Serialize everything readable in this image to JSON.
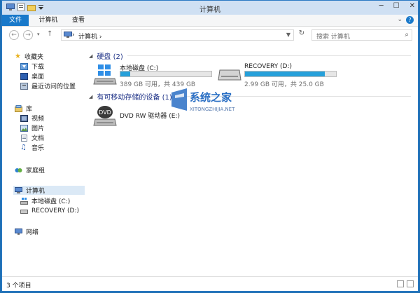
{
  "window": {
    "title": "计算机"
  },
  "ribbon": {
    "tabs": [
      "文件",
      "计算机",
      "查看"
    ],
    "help": "?"
  },
  "address": {
    "path": "计算机",
    "separator": "›"
  },
  "search": {
    "placeholder": "搜索 计算机"
  },
  "nav": {
    "favorites": "收藏夹",
    "favorite_items": [
      "下载",
      "桌面",
      "最近访问的位置"
    ],
    "libraries": "库",
    "library_items": [
      "视频",
      "图片",
      "文档",
      "音乐"
    ],
    "homegroup": "家庭组",
    "computer": "计算机",
    "computer_items": [
      "本地磁盘 (C:)",
      "RECOVERY (D:)"
    ],
    "network": "网络"
  },
  "content": {
    "hard_disks": {
      "title": "硬盘 (2)"
    },
    "drives": [
      {
        "name": "本地磁盘 (C:)",
        "free": "389 GB 可用，共 439 GB",
        "used_fraction": 0.11
      },
      {
        "name": "RECOVERY (D:)",
        "free": "2.99 GB 可用，共 25.0 GB",
        "used_fraction": 0.88
      }
    ],
    "removable": {
      "title": "有可移动存储的设备 (1)"
    },
    "dvd": {
      "name": "DVD RW 驱动器 (E:)",
      "badge": "DVD"
    }
  },
  "status": {
    "count": "3 个项目"
  },
  "watermark": {
    "title": "系统之家",
    "url": "XITONGZHIJIA.NET"
  },
  "colors": {
    "accent": "#1979ca",
    "bar": "#26a0da",
    "group_title": "#1e3287"
  }
}
